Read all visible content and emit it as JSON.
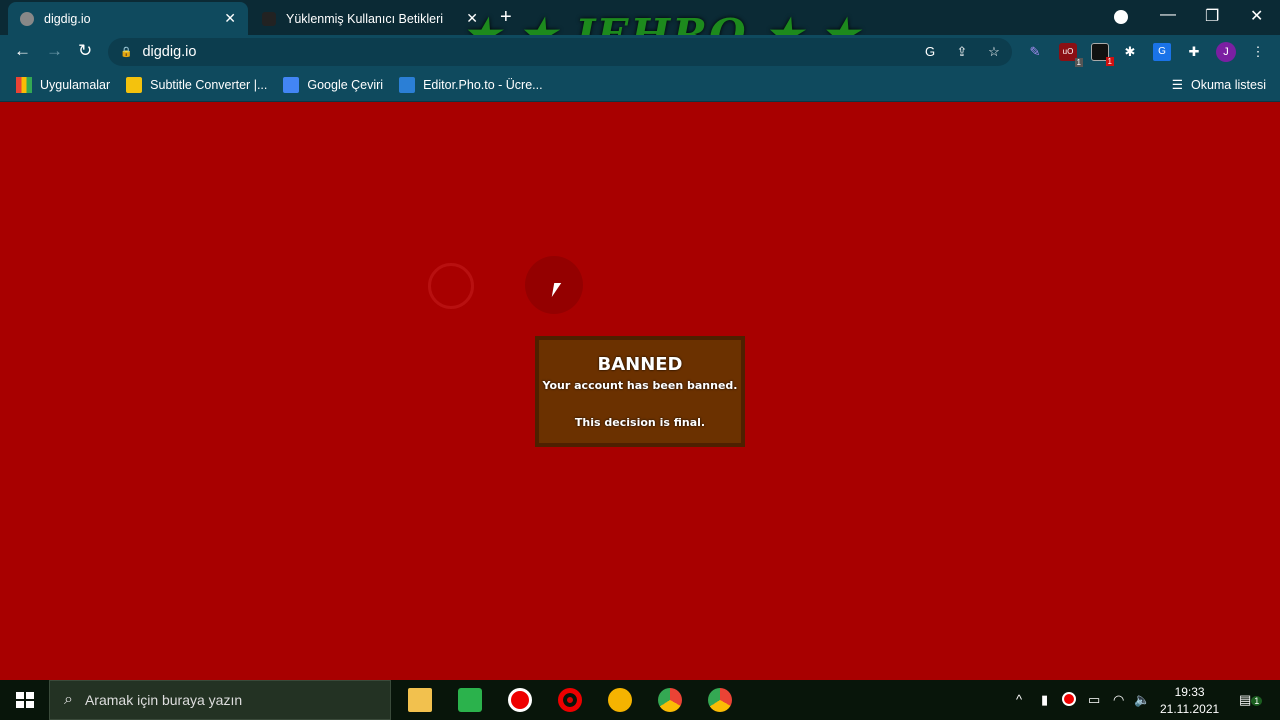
{
  "browser": {
    "tabs": [
      {
        "title": "digdig.io",
        "active": true,
        "icon": "globe-icon"
      },
      {
        "title": "Yüklenmiş Kullanıcı Betikleri",
        "active": false,
        "icon": "tampermonkey-icon"
      }
    ],
    "new_tab": "+",
    "watermark": "★ ★ JEHRO ★ ★",
    "address": "digdig.io",
    "extensions": [
      {
        "icon": "translate-icon"
      },
      {
        "icon": "share-icon"
      },
      {
        "icon": "star-icon"
      },
      {
        "icon": "feather-icon"
      },
      {
        "icon": "ublock-icon",
        "badge": "1"
      },
      {
        "icon": "screen-capture-icon",
        "badge": "1"
      },
      {
        "icon": "spider-icon"
      },
      {
        "icon": "google-translate-icon"
      },
      {
        "icon": "puzzle-icon"
      }
    ],
    "profile_initial": "J",
    "bookmarks": [
      {
        "label": "Uygulamalar",
        "icon": "apps-grid-icon"
      },
      {
        "label": "Subtitle Converter |...",
        "icon": "subtitle-icon"
      },
      {
        "label": "Google Çeviri",
        "icon": "google-translate-icon"
      },
      {
        "label": "Editor.Pho.to - Ücre...",
        "icon": "photo-icon"
      }
    ],
    "reading_list": "Okuma listesi"
  },
  "game": {
    "dialog": {
      "title": "BANNED",
      "message": "Your account has been banned.",
      "note": "This decision is final."
    },
    "colors": {
      "background": "#a80000",
      "dialog": "#6b3100",
      "dialog_border": "#4e2000"
    }
  },
  "taskbar": {
    "search_placeholder": "Aramak için buraya yazın",
    "apps": [
      "file-explorer-icon",
      "camtasia-icon",
      "recorder-icon",
      "opera-icon",
      "yellow-app-icon",
      "chrome-icon",
      "chrome-profile-icon"
    ],
    "time": "19:33",
    "date": "21.11.2021",
    "notifications": "1"
  }
}
